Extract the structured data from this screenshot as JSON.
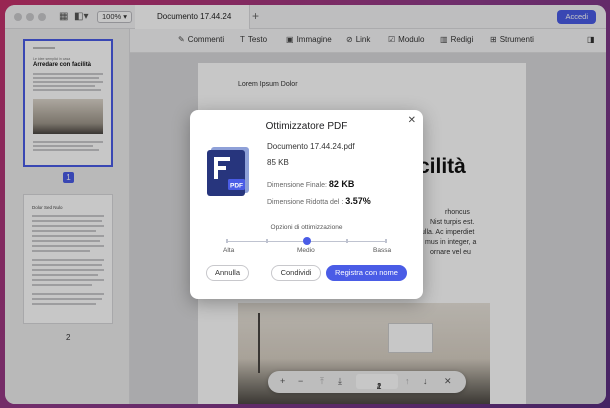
{
  "window": {
    "zoom": "100%",
    "tab_title": "Documento 17.44.24",
    "login_button": "Accedi"
  },
  "toolbar": {
    "items": [
      "Commenti",
      "Testo",
      "Immagine",
      "Link",
      "Modulo",
      "Redigi",
      "Strumenti"
    ]
  },
  "sidebar": {
    "page1_title": "Arredare con facilità",
    "page1_subtitle": "Le idee semplici in casa",
    "page2_title": "Dolor Sed Nulo",
    "page_numbers": [
      "1",
      "2"
    ]
  },
  "document": {
    "header": "Lorem Ipsum Dolor",
    "title_fragment": "cilità",
    "body_lines": [
      "rhoncus",
      "Nist turpis est.",
      "ulla. Ac imperdiet",
      "mus in integer, a",
      "ornare vel eu"
    ]
  },
  "page_nav": {
    "current": "1",
    "separator": "/",
    "total": "2"
  },
  "dialog": {
    "title": "Ottimizzatore PDF",
    "file_name": "Documento 17.44.24.pdf",
    "file_size": "85 KB",
    "final_size_label": "Dimensione Finale:",
    "final_size_value": "82 KB",
    "reduced_label": "Dimensione Ridotta del :",
    "reduced_value": "3.57%",
    "options_title": "Opzioni di ottimizzazione",
    "levels": [
      "Alta",
      "Medio",
      "Bassa"
    ],
    "selected_level": "Medio",
    "cancel": "Annulla",
    "share": "Condividi",
    "save": "Registra con nome",
    "icon_label": "PDF"
  }
}
